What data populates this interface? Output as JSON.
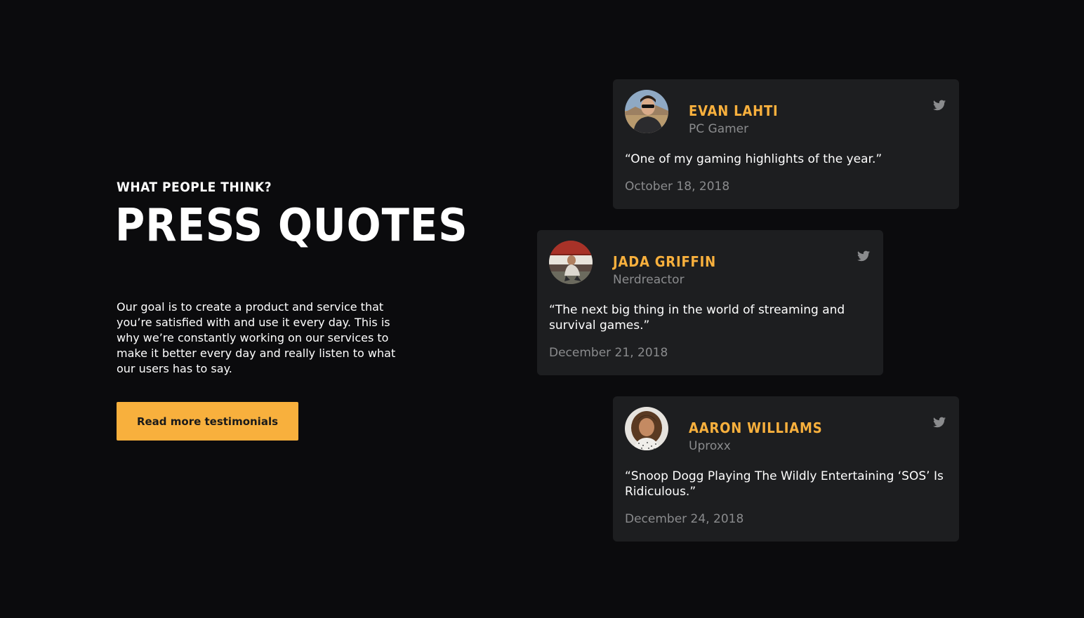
{
  "section": {
    "eyebrow": "WHAT PEOPLE THINK?",
    "title": "PRESS QUOTES",
    "description": "Our goal is to create a product and service that you’re satisfied with and use it every day. This is why we’re constantly working on our services to make it better every day and really listen to what our users has to say.",
    "cta_label": "Read more testimonials"
  },
  "testimonials": [
    {
      "name": "EVAN LAHTI",
      "outlet": "PC Gamer",
      "quote": "“One of my gaming highlights of the year.”",
      "date": "October 18, 2018",
      "icon": "twitter-icon"
    },
    {
      "name": "JADA GRIFFIN",
      "outlet": "Nerdreactor",
      "quote": "“The next big thing in the world of streaming and survival games.”",
      "date": "December 21, 2018",
      "icon": "twitter-icon"
    },
    {
      "name": "AARON WILLIAMS",
      "outlet": "Uproxx",
      "quote": "“Snoop Dogg Playing The Wildly Entertaining ‘SOS’ Is Ridiculous.”",
      "date": "December 24, 2018",
      "icon": "twitter-icon"
    }
  ],
  "colors": {
    "background": "#0b0b0d",
    "card": "#1d1e20",
    "accent": "#f8b03d",
    "muted": "#8a8b8d"
  }
}
